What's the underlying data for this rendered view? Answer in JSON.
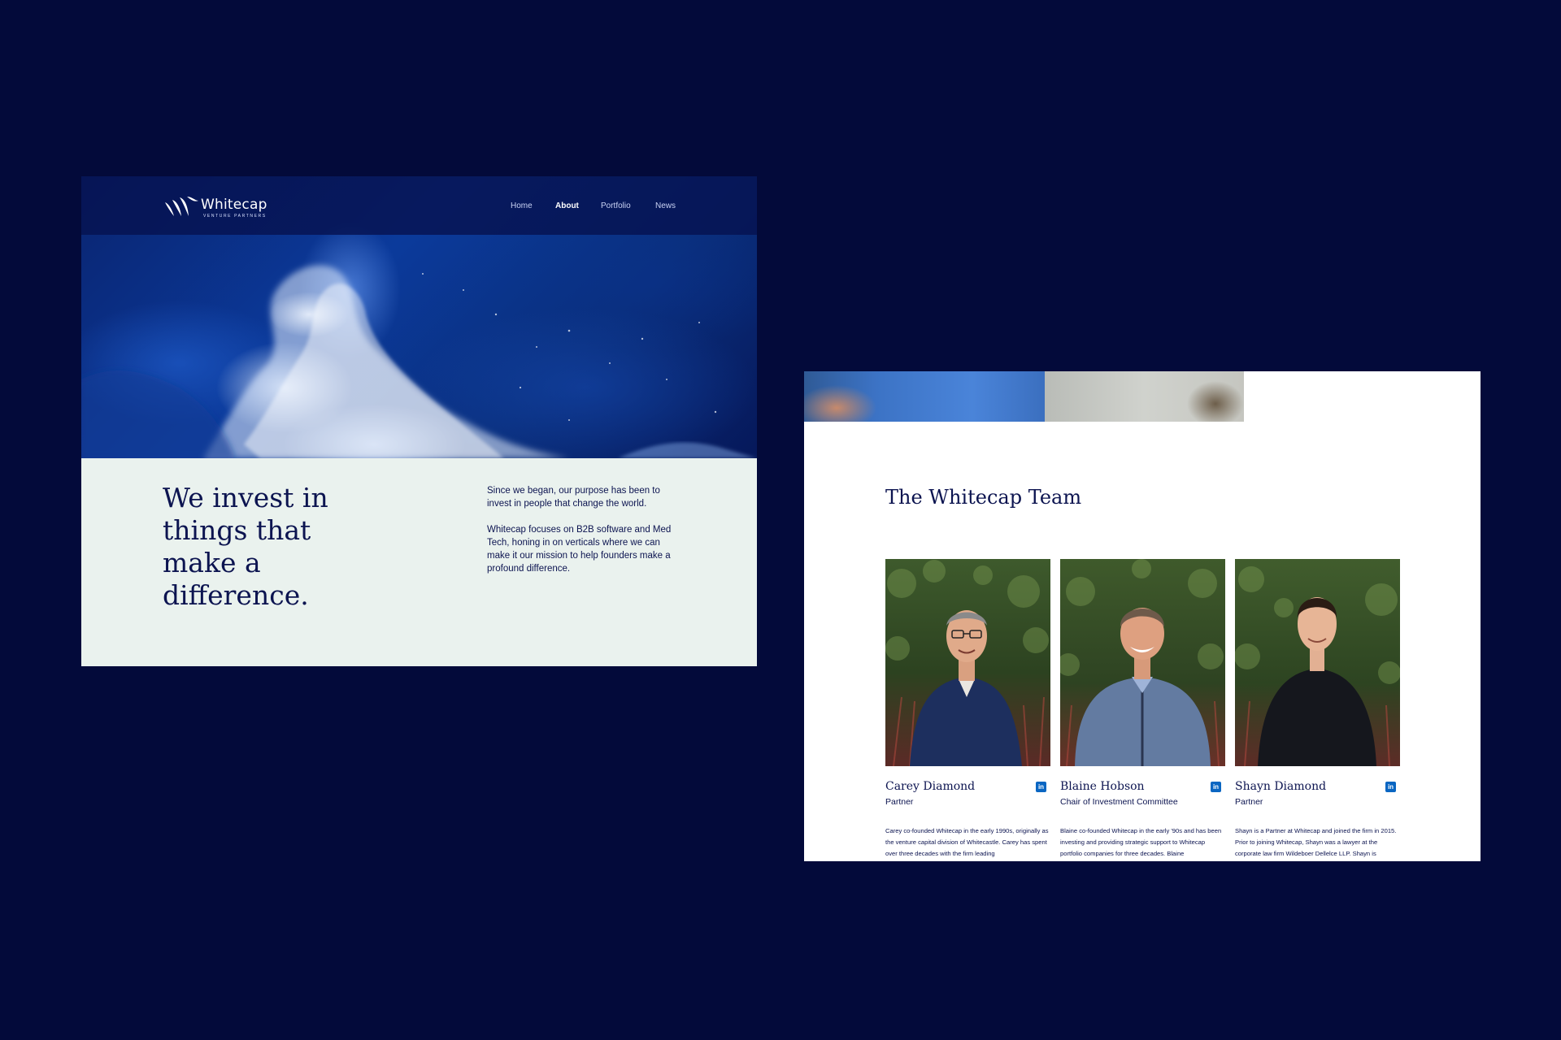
{
  "brand": {
    "name": "Whitecap",
    "tagline": "VENTURE PARTNERS"
  },
  "nav": {
    "items": [
      {
        "label": "Home",
        "active": false
      },
      {
        "label": "About",
        "active": true
      },
      {
        "label": "Portfolio",
        "active": false
      },
      {
        "label": "News",
        "active": false
      }
    ]
  },
  "hero": {
    "headline": "We invest in things that make a difference.",
    "paragraphs": [
      "Since we began, our purpose has been to invest in people that change the world.",
      "Whitecap focuses on B2B software and Med Tech, honing in on verticals where we can make it our mission to help founders make a profound difference."
    ]
  },
  "team": {
    "title": "The Whitecap Team",
    "members": [
      {
        "name": "Carey Diamond",
        "role": "Partner",
        "bio": "Carey co-founded Whitecap in the early 1990s, originally as the venture capital division of Whitecastle. Carey has spent over three decades with the firm leading",
        "icon": "linkedin-icon"
      },
      {
        "name": "Blaine Hobson",
        "role": "Chair of Investment Committee",
        "bio": "Blaine co-founded Whitecap in the early '90s and has been investing and providing strategic support to Whitecap portfolio companies for three decades. Blaine",
        "icon": "linkedin-icon"
      },
      {
        "name": "Shayn Diamond",
        "role": "Partner",
        "bio": "Shayn is a Partner at Whitecap and joined the firm in 2015. Prior to joining Whitecap, Shayn was a lawyer at the corporate law firm Wildeboer Dellelce LLP. Shayn is",
        "icon": "linkedin-icon"
      }
    ]
  },
  "colors": {
    "background": "#030a3a",
    "navy_text": "#0c1450",
    "mint_panel": "#eaf2ee",
    "linkedin": "#0a66c2"
  }
}
